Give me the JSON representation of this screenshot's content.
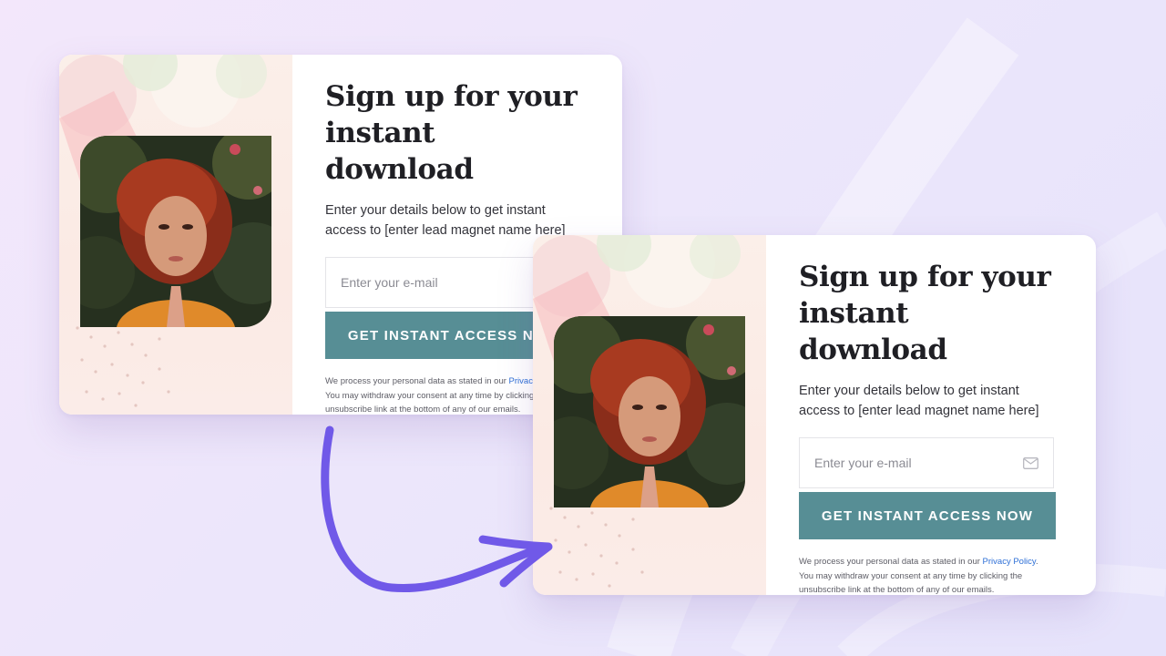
{
  "form": {
    "title_line1": "Sign up for your",
    "title_line2": "instant download",
    "desc_line1": "Enter your details below to get instant",
    "desc_line2": "access to [enter lead magnet name here]",
    "email_placeholder": "Enter your e-mail",
    "cta_label": "GET INSTANT ACCESS NOW",
    "legal_prefix": "We process your personal data as stated in our ",
    "privacy_link": "Privacy Policy",
    "legal_suffix": ".",
    "legal_line2": "You may withdraw your consent at any time by clicking the",
    "legal_line3": "unsubscribe link at the bottom of any of our emails."
  },
  "colors": {
    "accent_teal": "#578e95",
    "arrow_purple": "#7059e8",
    "link_blue": "#2d6fd6",
    "art_blush": "#fbeae4"
  },
  "icons": {
    "email_field": "mail-icon"
  }
}
